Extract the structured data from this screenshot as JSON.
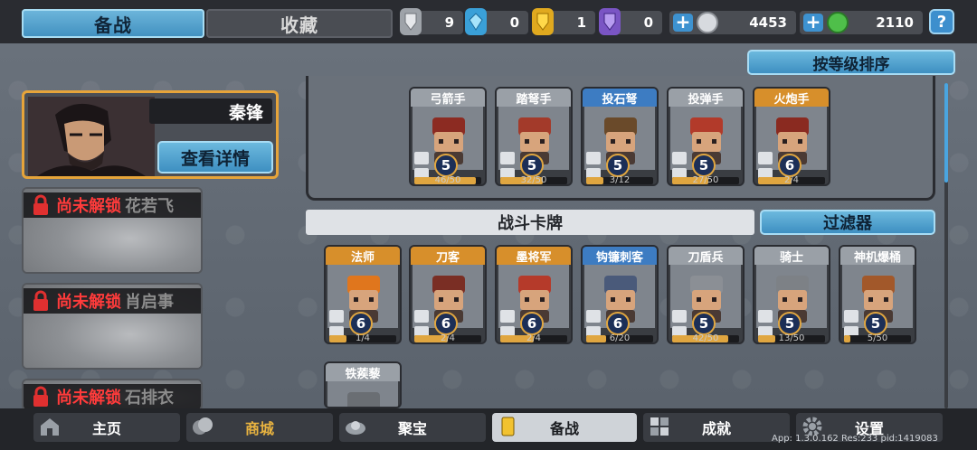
{
  "tabs": {
    "prepare": "备战",
    "collection": "收藏"
  },
  "resources": [
    {
      "icon": "silver-crest-icon",
      "value": "9",
      "color": "#bfc3c8"
    },
    {
      "icon": "blue-crystal-icon",
      "value": "0",
      "color": "#64c6ef"
    },
    {
      "icon": "gold-crest-icon",
      "value": "1",
      "color": "#f0c02a"
    },
    {
      "icon": "purple-crest-icon",
      "value": "0",
      "color": "#8a5fd0"
    },
    {
      "icon": "silver-coin-icon",
      "value": "4453",
      "color": "#d7dadf"
    },
    {
      "icon": "green-gem-icon",
      "value": "2110",
      "color": "#4fbf4a"
    }
  ],
  "help_label": "?",
  "hero": {
    "name": "秦锋",
    "detail_button": "查看详情"
  },
  "locked_heroes": [
    {
      "status": "尚未解锁",
      "name": "花若飞"
    },
    {
      "status": "尚未解锁",
      "name": "肖启事"
    },
    {
      "status": "尚未解锁",
      "name": "石排衣"
    }
  ],
  "sort_button": "按等级排序",
  "deck_cards": [
    {
      "name": "弓箭手",
      "level": "5",
      "progress": "46/50",
      "header": "gray",
      "fill": 0.92
    },
    {
      "name": "踏弩手",
      "level": "5",
      "progress": "32/50",
      "header": "gray",
      "fill": 0.64
    },
    {
      "name": "投石弩",
      "level": "5",
      "progress": "3/12",
      "header": "blue",
      "fill": 0.25
    },
    {
      "name": "投弹手",
      "level": "5",
      "progress": "27/50",
      "header": "gray",
      "fill": 0.54
    },
    {
      "name": "火炮手",
      "level": "6",
      "progress": "2/4",
      "header": "orange",
      "fill": 0.5
    }
  ],
  "battle_cards_title": "战斗卡牌",
  "filter_button": "过滤器",
  "battle_cards": [
    {
      "name": "法师",
      "level": "6",
      "progress": "1/4",
      "header": "orange",
      "fill": 0.25
    },
    {
      "name": "刀客",
      "level": "6",
      "progress": "2/4",
      "header": "orange",
      "fill": 0.5
    },
    {
      "name": "墨将军",
      "level": "6",
      "progress": "2/4",
      "header": "orange",
      "fill": 0.5
    },
    {
      "name": "钩镰刺客",
      "level": "6",
      "progress": "6/20",
      "header": "blue",
      "fill": 0.3
    },
    {
      "name": "刀盾兵",
      "level": "5",
      "progress": "42/50",
      "header": "gray",
      "fill": 0.84
    },
    {
      "name": "骑士",
      "level": "5",
      "progress": "13/50",
      "header": "gray",
      "fill": 0.26
    },
    {
      "name": "神机爆桶",
      "level": "5",
      "progress": "5/50",
      "header": "gray",
      "fill": 0.1
    },
    {
      "name": "铁蒺藜",
      "level": "",
      "progress": "",
      "header": "gray",
      "fill": 0
    }
  ],
  "nav": [
    {
      "label": "主页",
      "icon": "home-icon",
      "color": "#ffffff"
    },
    {
      "label": "商城",
      "icon": "shop-icon",
      "color": "#e8b340"
    },
    {
      "label": "聚宝",
      "icon": "treasure-icon",
      "color": "#ffffff"
    },
    {
      "label": "备战",
      "icon": "cards-icon",
      "color": "#1a1c20"
    },
    {
      "label": "成就",
      "icon": "achievement-icon",
      "color": "#ffffff"
    },
    {
      "label": "设置",
      "icon": "gear-icon",
      "color": "#ffffff"
    }
  ],
  "footer": "App: 1.3.0.162 Res:233 pid:1419083"
}
